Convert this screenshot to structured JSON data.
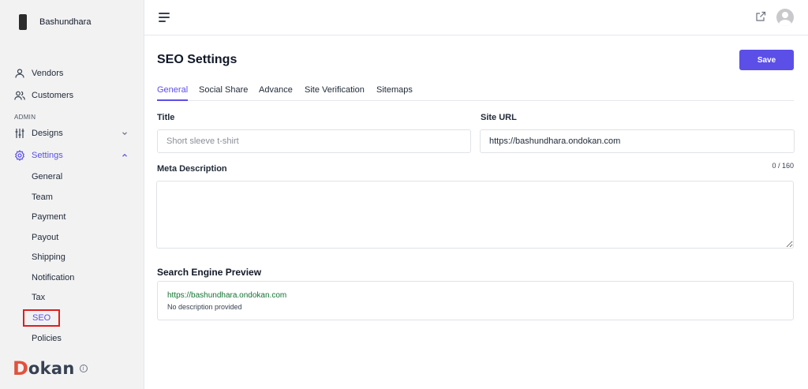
{
  "store": {
    "name": "Bashundhara"
  },
  "sidebar": {
    "vendors_label": "Vendors",
    "customers_label": "Customers",
    "admin_section": "ADMIN",
    "designs_label": "Designs",
    "settings_label": "Settings",
    "settings_sub": [
      "General",
      "Team",
      "Payment",
      "Payout",
      "Shipping",
      "Notification",
      "Tax",
      "SEO",
      "Policies"
    ],
    "selected_sub": "SEO"
  },
  "brand": {
    "first_letter": "D",
    "rest": "okan",
    "info_glyph": "i"
  },
  "page": {
    "title": "SEO Settings",
    "save_label": "Save"
  },
  "tabs": [
    "General",
    "Social Share",
    "Advance",
    "Site Verification",
    "Sitemaps"
  ],
  "active_tab": "General",
  "form": {
    "title_label": "Title",
    "title_placeholder": "Short sleeve t-shirt",
    "site_url_label": "Site URL",
    "site_url_value": "https://bashundhara.ondokan.com",
    "meta_label": "Meta Description",
    "meta_counter": "0 / 160",
    "meta_value": ""
  },
  "preview": {
    "section_title": "Search Engine Preview",
    "url": "https://bashundhara.ondokan.com",
    "description": "No description provided"
  },
  "colors": {
    "accent": "#5b4fe8",
    "brand_red": "#e1523d",
    "highlight_box": "#e01e1e",
    "preview_url": "#137333"
  },
  "icons": [
    "store-logo-icon",
    "user-icon",
    "users-icon",
    "sliders-icon",
    "gear-icon",
    "chevron-down-icon",
    "chevron-up-icon",
    "menu-icon",
    "external-link-icon",
    "avatar-icon",
    "info-icon"
  ]
}
